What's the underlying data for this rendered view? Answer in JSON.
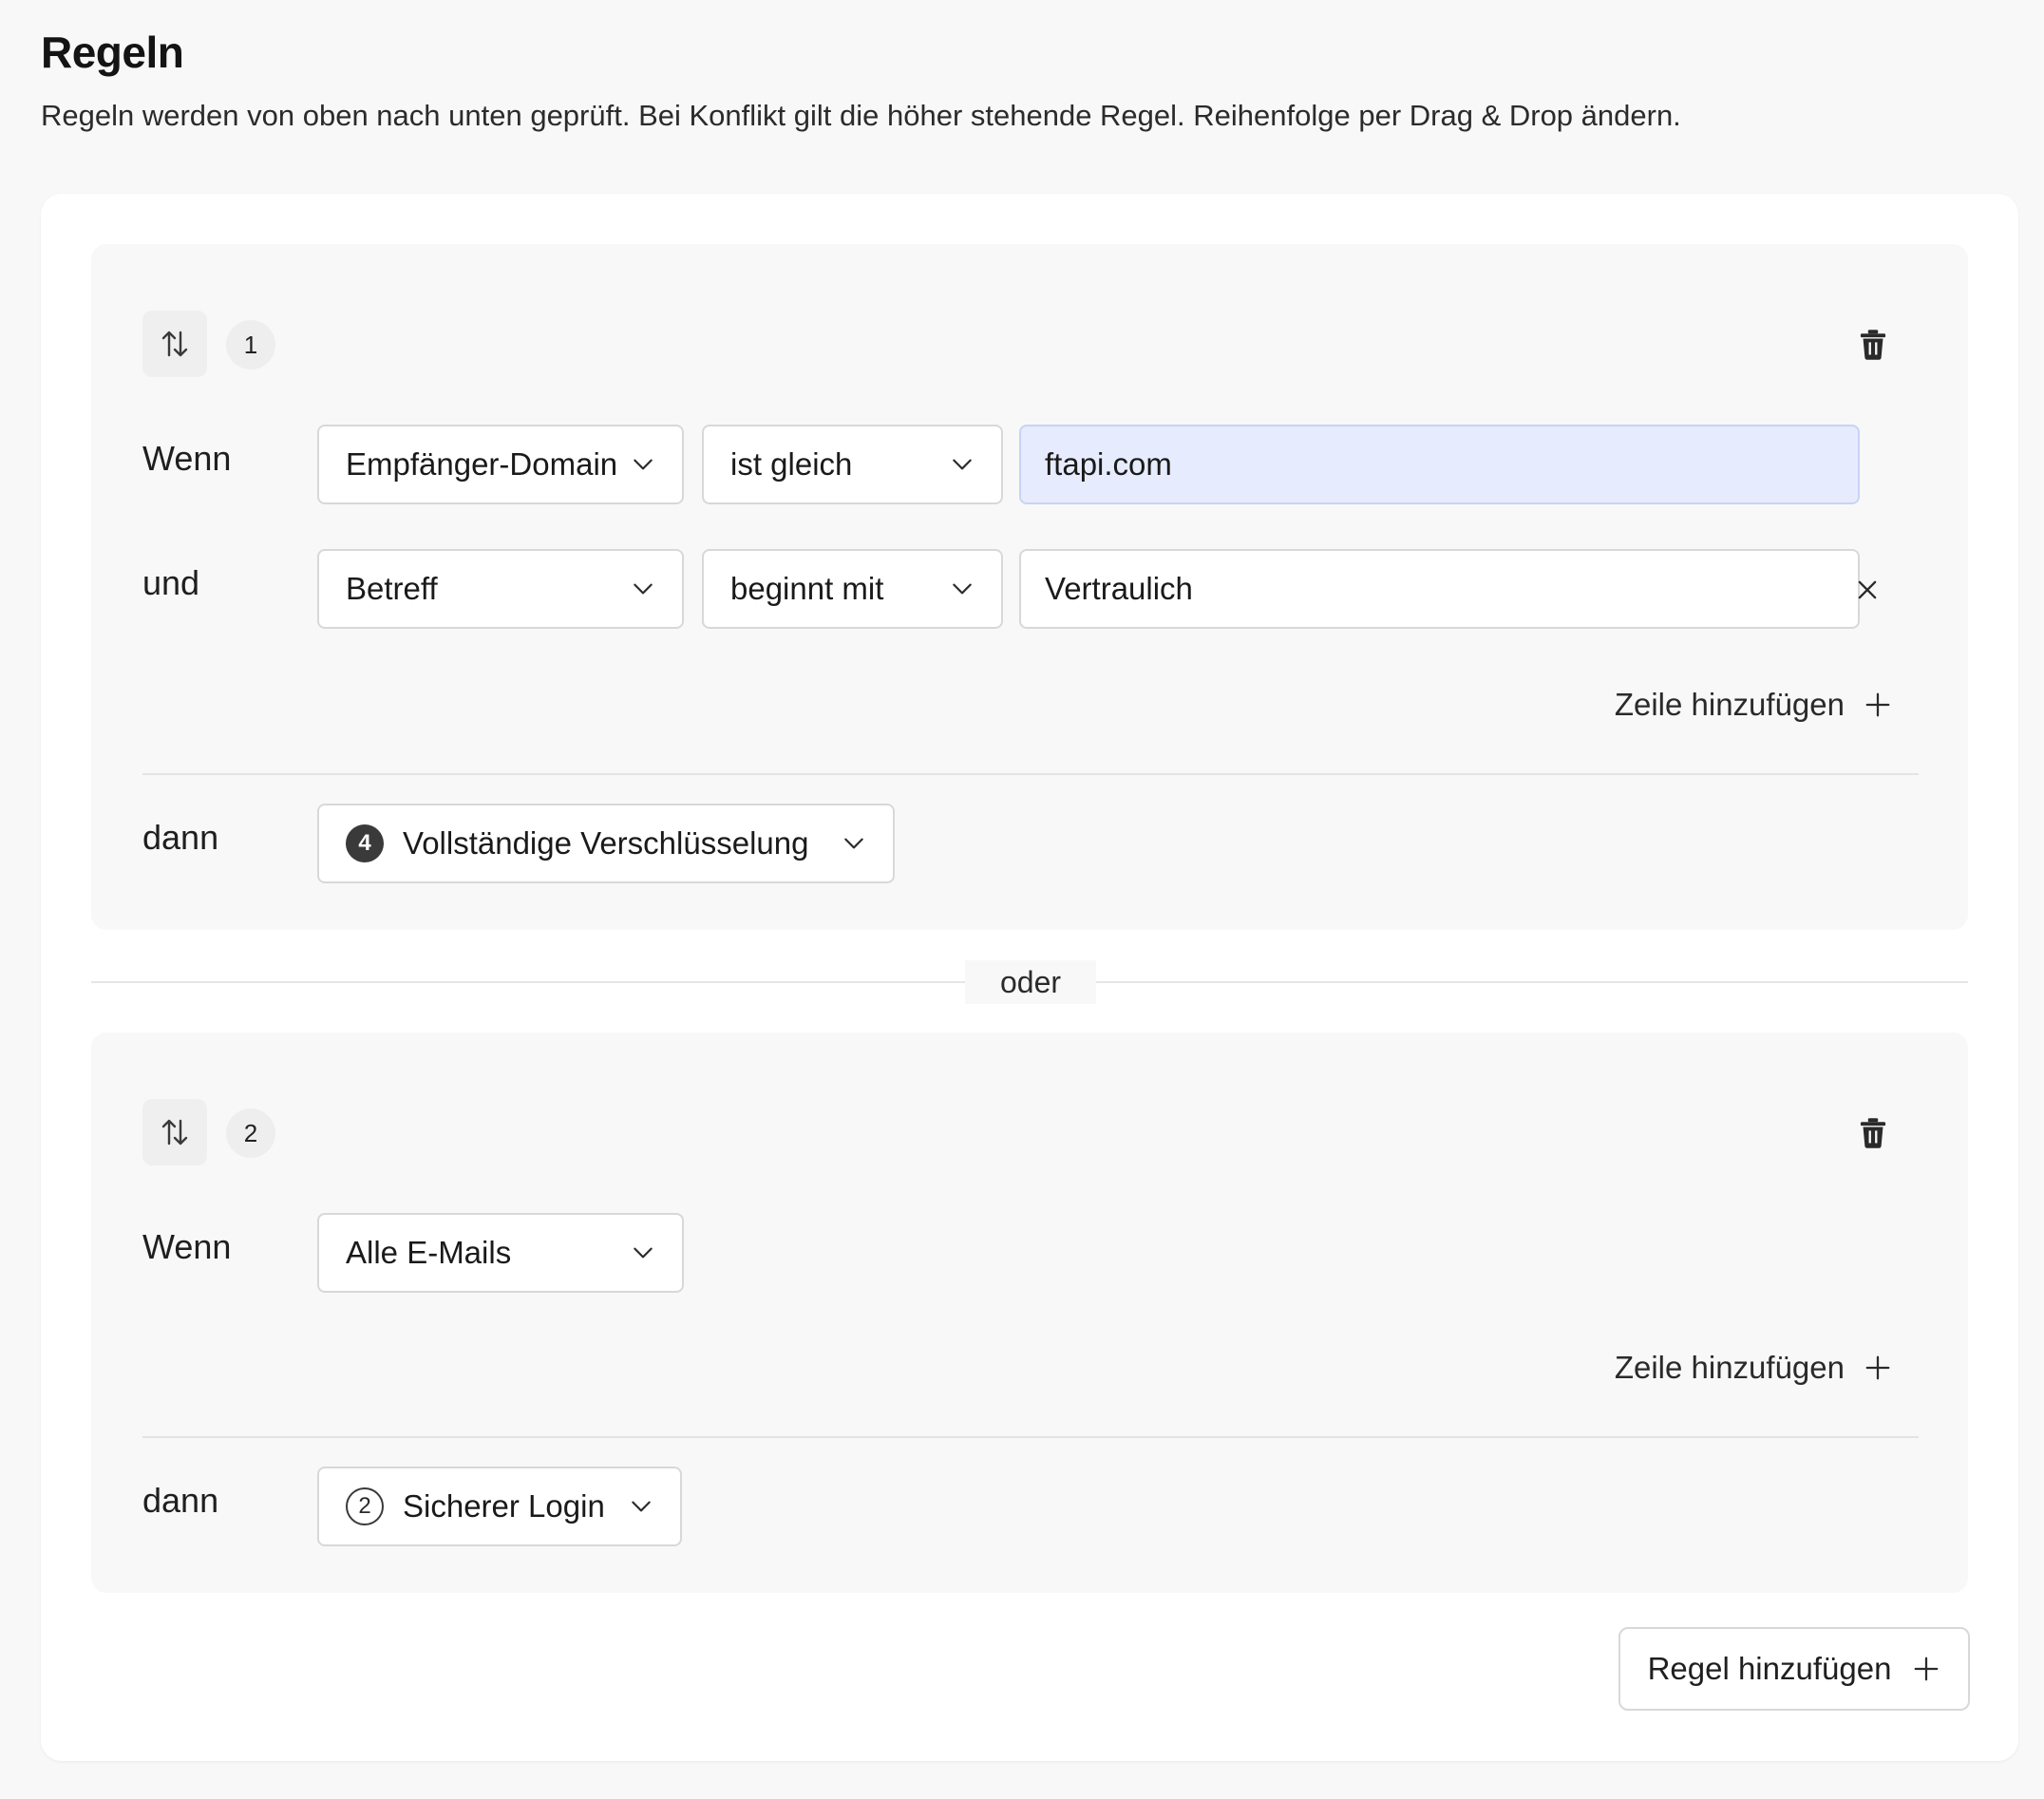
{
  "header": {
    "title": "Regeln",
    "description": "Regeln werden von oben nach unten geprüft. Bei Konflikt gilt die höher stehende Regel. Reihenfolge per Drag & Drop ändern."
  },
  "icons": {
    "handle": "sort-arrows-icon",
    "delete": "trash-icon",
    "chevron": "chevron-down-icon",
    "remove": "close-icon",
    "add": "plus-icon"
  },
  "colors": {
    "focused_input_bg": "#e6ecfd",
    "page_bg": "#f8f8f8",
    "card_bg": "#ffffff"
  },
  "rules": [
    {
      "number": "1",
      "conditions": [
        {
          "label": "Wenn",
          "field": "Empfänger-Domain",
          "operator": "ist gleich",
          "value": "ftapi.com"
        },
        {
          "label": "und",
          "field": "Betreff",
          "operator": "beginnt mit",
          "value": "Vertraulich"
        }
      ],
      "add_row_label": "Zeile hinzufügen",
      "then_label": "dann",
      "action": {
        "level": "4",
        "label": "Vollständige Verschlüsselung"
      }
    },
    {
      "number": "2",
      "conditions": [
        {
          "label": "Wenn",
          "field": "Alle E-Mails"
        }
      ],
      "add_row_label": "Zeile hinzufügen",
      "then_label": "dann",
      "action": {
        "level": "2",
        "label": "Sicherer Login"
      }
    }
  ],
  "separator_label": "oder",
  "add_rule_label": "Regel hinzufügen"
}
